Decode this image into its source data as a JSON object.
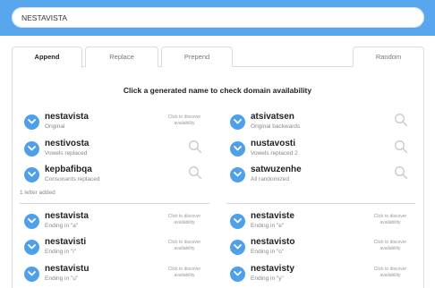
{
  "search": {
    "value": "NESTAVISTA"
  },
  "tabs": [
    {
      "label": "Append"
    },
    {
      "label": "Replace"
    },
    {
      "label": "Prepend"
    },
    {
      "label": "Random"
    }
  ],
  "heading": "Click a generated name to check domain availability",
  "section_label": "1 letter added",
  "hint_text": "Click to discover availability",
  "colors": {
    "topbar": "#57a6ee",
    "accent": "#4fa0ea"
  },
  "items": [
    {
      "name": "nestavista",
      "sub": "Original"
    },
    {
      "name": "atsivatsen",
      "sub": "Original backwards"
    },
    {
      "name": "nestivosta",
      "sub": "Vowels replaced"
    },
    {
      "name": "nustavosti",
      "sub": "Vowels replaced 2"
    },
    {
      "name": "kepbafibqa",
      "sub": "Consonants replaced"
    },
    {
      "name": "satwuzenhe",
      "sub": "All randomized"
    },
    {
      "name": "nestavista",
      "sub": "Ending in \"a\""
    },
    {
      "name": "nestaviste",
      "sub": "Ending in \"e\""
    },
    {
      "name": "nestavisti",
      "sub": "Ending in \"i\""
    },
    {
      "name": "nestavisto",
      "sub": "Ending in \"o\""
    },
    {
      "name": "nestavistu",
      "sub": "Ending in \"u\""
    },
    {
      "name": "nestavisty",
      "sub": "Ending in \"y\""
    }
  ]
}
